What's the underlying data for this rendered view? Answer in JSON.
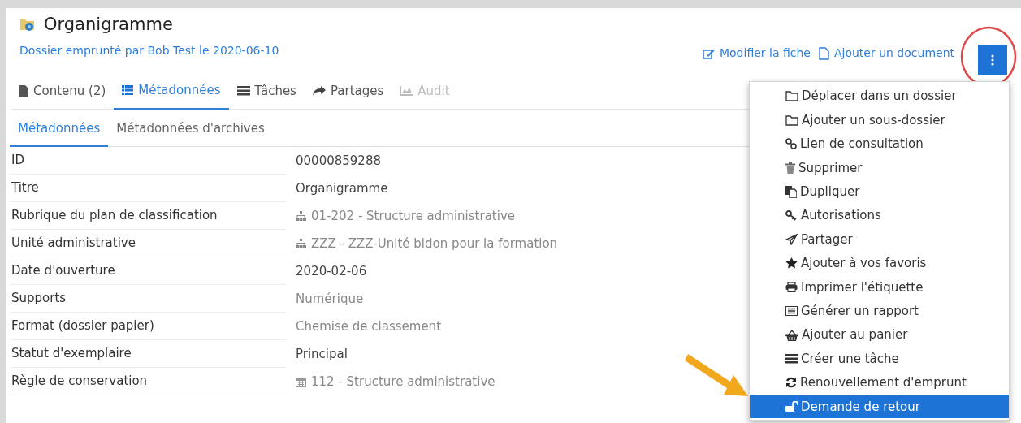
{
  "header": {
    "title": "Organigramme",
    "subtitle": "Dossier emprunté par Bob Test le 2020-06-10"
  },
  "actions": [
    "Modifier la fiche",
    "Ajouter un document"
  ],
  "tabs": [
    {
      "label": "Contenu (2)",
      "selected": false,
      "disabled": false
    },
    {
      "label": "Métadonnées",
      "selected": true,
      "disabled": false
    },
    {
      "label": "Tâches",
      "selected": false,
      "disabled": false
    },
    {
      "label": "Partages",
      "selected": false,
      "disabled": false
    },
    {
      "label": "Audit",
      "selected": false,
      "disabled": true
    }
  ],
  "subtabs": [
    {
      "label": "Métadonnées",
      "selected": true
    },
    {
      "label": "Métadonnées d'archives",
      "selected": false
    }
  ],
  "rows": [
    {
      "label": "ID",
      "value": "00000859288",
      "kind": "plain"
    },
    {
      "label": "Titre",
      "value": "Organigramme",
      "kind": "plain"
    },
    {
      "label": "Rubrique du plan de classification",
      "value": "01-202 - Structure administrative",
      "kind": "tree"
    },
    {
      "label": "Unité administrative",
      "value": "ZZZ - ZZZ-Unité bidon pour la formation",
      "kind": "tree"
    },
    {
      "label": "Date d'ouverture",
      "value": "2020-02-06",
      "kind": "plain"
    },
    {
      "label": "Supports",
      "value": "Numérique",
      "kind": "muted"
    },
    {
      "label": "Format (dossier papier)",
      "value": "Chemise de classement",
      "kind": "muted"
    },
    {
      "label": "Statut d'exemplaire",
      "value": "Principal",
      "kind": "plain"
    },
    {
      "label": "Règle de conservation",
      "value": "112 - Structure administrative",
      "kind": "calendar"
    }
  ],
  "menu": [
    {
      "label": "Déplacer dans un dossier",
      "selected": false
    },
    {
      "label": "Ajouter un sous-dossier",
      "selected": false
    },
    {
      "label": "Lien de consultation",
      "selected": false
    },
    {
      "label": "Supprimer",
      "selected": false
    },
    {
      "label": "Dupliquer",
      "selected": false
    },
    {
      "label": "Autorisations",
      "selected": false
    },
    {
      "label": "Partager",
      "selected": false
    },
    {
      "label": "Ajouter à vos favoris",
      "selected": false
    },
    {
      "label": "Imprimer l'étiquette",
      "selected": false
    },
    {
      "label": "Générer un rapport",
      "selected": false
    },
    {
      "label": "Ajouter au panier",
      "selected": false
    },
    {
      "label": "Créer une tâche",
      "selected": false
    },
    {
      "label": "Renouvellement d'emprunt",
      "selected": false
    },
    {
      "label": "Demande de retour",
      "selected": true
    }
  ]
}
